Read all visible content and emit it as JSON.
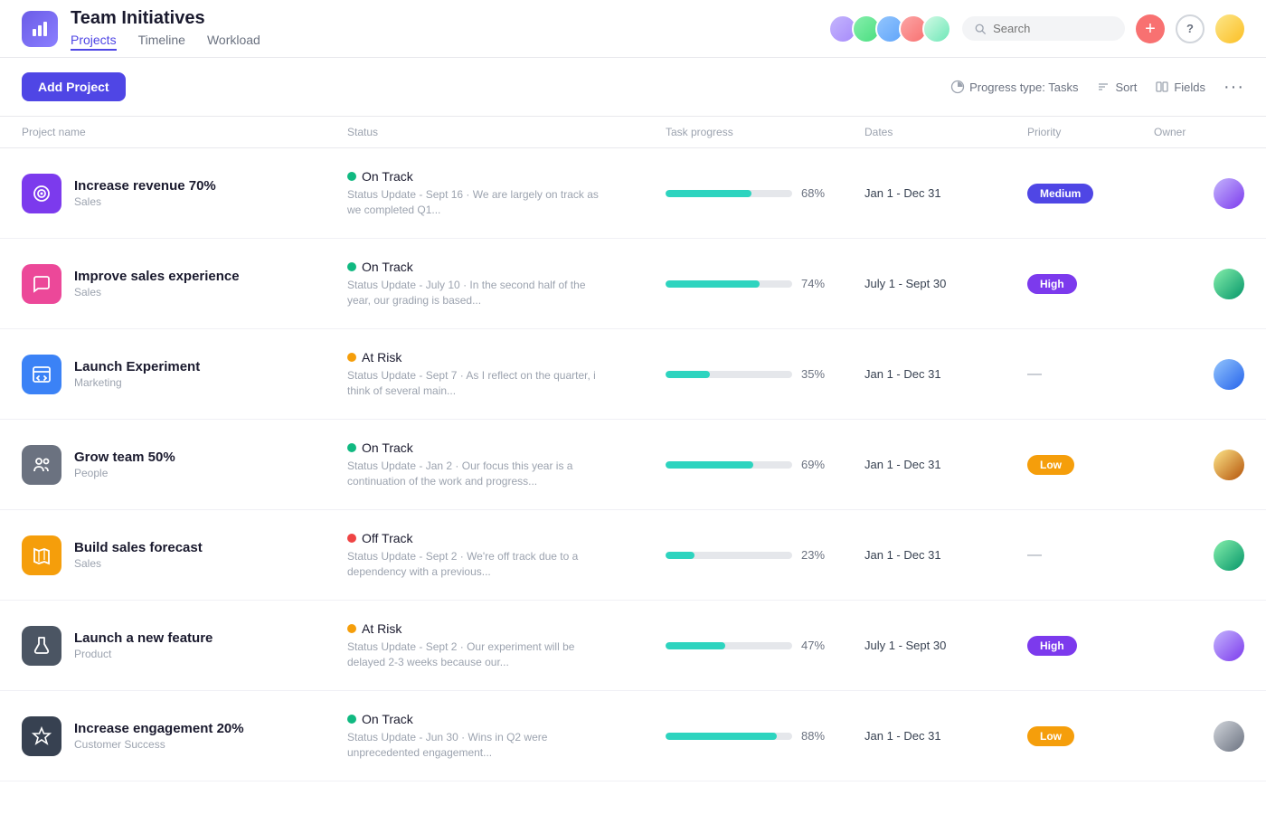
{
  "app": {
    "icon_label": "chart-icon",
    "title": "Team Initiatives",
    "nav": [
      {
        "label": "Projects",
        "active": true
      },
      {
        "label": "Timeline",
        "active": false
      },
      {
        "label": "Workload",
        "active": false
      }
    ]
  },
  "header": {
    "search_placeholder": "Search",
    "add_label": "+",
    "help_label": "?",
    "avatars": [
      "av1",
      "av2",
      "av3",
      "av4",
      "av5"
    ]
  },
  "toolbar": {
    "add_project_label": "Add Project",
    "progress_type_label": "Progress type: Tasks",
    "sort_label": "Sort",
    "fields_label": "Fields",
    "more_label": "···"
  },
  "table": {
    "columns": [
      "Project name",
      "Status",
      "Task progress",
      "Dates",
      "Priority",
      "Owner"
    ],
    "rows": [
      {
        "id": 1,
        "name": "Increase revenue 70%",
        "team": "Sales",
        "icon_color": "icon-purple",
        "icon_type": "target",
        "status": "On Track",
        "status_type": "green",
        "update": "Status Update - Sept 16 · We are largely on track as we completed Q1...",
        "progress": 68,
        "dates": "Jan 1 - Dec 31",
        "priority": "Medium",
        "priority_type": "medium",
        "owner_color": "av1"
      },
      {
        "id": 2,
        "name": "Improve sales experience",
        "team": "Sales",
        "icon_color": "icon-pink",
        "icon_type": "chat",
        "status": "On Track",
        "status_type": "green",
        "update": "Status Update - July 10 · In the second half of the year, our grading is based...",
        "progress": 74,
        "dates": "July 1 - Sept 30",
        "priority": "High",
        "priority_type": "high",
        "owner_color": "av2"
      },
      {
        "id": 3,
        "name": "Launch Experiment",
        "team": "Marketing",
        "icon_color": "icon-blue",
        "icon_type": "code",
        "status": "At Risk",
        "status_type": "orange",
        "update": "Status Update - Sept 7 · As I reflect on the quarter, i think of several main...",
        "progress": 35,
        "dates": "Jan 1 - Dec 31",
        "priority": "",
        "priority_type": "none",
        "owner_color": "av3"
      },
      {
        "id": 4,
        "name": "Grow team 50%",
        "team": "People",
        "icon_color": "icon-gray",
        "icon_type": "people",
        "status": "On Track",
        "status_type": "green",
        "update": "Status Update - Jan 2 · Our focus this year is a continuation of the work and progress...",
        "progress": 69,
        "dates": "Jan 1 - Dec 31",
        "priority": "Low",
        "priority_type": "low",
        "owner_color": "av4"
      },
      {
        "id": 5,
        "name": "Build sales forecast",
        "team": "Sales",
        "icon_color": "icon-orange",
        "icon_type": "map",
        "status": "Off Track",
        "status_type": "red",
        "update": "Status Update - Sept 2 · We're off track due to a dependency with a previous...",
        "progress": 23,
        "dates": "Jan 1 - Dec 31",
        "priority": "",
        "priority_type": "none",
        "owner_color": "av2"
      },
      {
        "id": 6,
        "name": "Launch a new feature",
        "team": "Product",
        "icon_color": "icon-darkgray",
        "icon_type": "flask",
        "status": "At Risk",
        "status_type": "orange",
        "update": "Status Update - Sept 2 · Our experiment will be delayed 2-3 weeks because our...",
        "progress": 47,
        "dates": "July 1 - Sept 30",
        "priority": "High",
        "priority_type": "high",
        "owner_color": "av1"
      },
      {
        "id": 7,
        "name": "Increase engagement 20%",
        "team": "Customer Success",
        "icon_color": "icon-darkgray2",
        "icon_type": "star",
        "status": "On Track",
        "status_type": "green",
        "update": "Status Update - Jun 30 · Wins in Q2 were unprecedented engagement...",
        "progress": 88,
        "dates": "Jan 1 - Dec 31",
        "priority": "Low",
        "priority_type": "low",
        "owner_color": "av5"
      }
    ]
  }
}
